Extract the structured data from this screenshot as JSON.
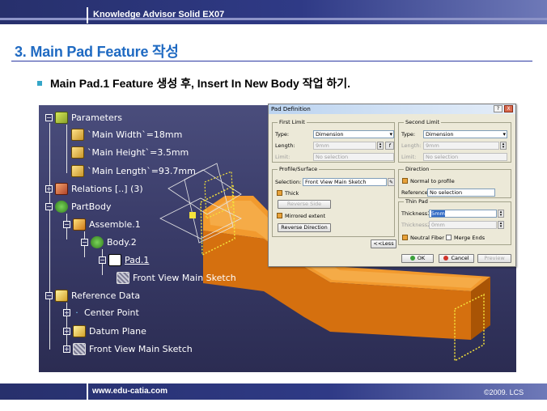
{
  "header": {
    "title": "Knowledge Advisor Solid EX07"
  },
  "slide": {
    "title": "3. Main Pad Feature 작성",
    "bullet": "Main Pad.1 Feature 생성 후,  Insert In New Body 작업 하기."
  },
  "tree": {
    "parameters": "Parameters",
    "main_width": "`Main Width`=18mm",
    "main_height": "`Main Height`=3.5mm",
    "main_length": "`Main Length`=93.7mm",
    "relations": "Relations [..] (3)",
    "partbody": "PartBody",
    "assemble": "Assemble.1",
    "body2": "Body.2",
    "pad1": "Pad.1",
    "front_sketch_1": "Front View Main Sketch",
    "reference_data": "Reference Data",
    "center_point": "Center Point",
    "datum_plane": "Datum Plane",
    "front_sketch_2": "Front View Main Sketch"
  },
  "dialog": {
    "title": "Pad Definition",
    "help": "?",
    "close": "X",
    "first_limit": {
      "label": "First Limit",
      "type_label": "Type:",
      "type_value": "Dimension",
      "length_label": "Length:",
      "length_value": "9mm",
      "limit_label": "Limit:",
      "limit_value": "No selection"
    },
    "second_limit": {
      "label": "Second Limit",
      "type_label": "Type:",
      "type_value": "Dimension",
      "length_label": "Length:",
      "length_value": "9mm",
      "limit_label": "Limit:",
      "limit_value": "No selection"
    },
    "profile": {
      "label": "Profile/Surface",
      "selection_label": "Selection:",
      "selection_value": "Front View Main Sketch",
      "thick_label": "Thick",
      "reverse_side": "Reverse Side",
      "mirrored_label": "Mirrored extent",
      "reverse_direction": "Reverse Direction"
    },
    "direction": {
      "label": "Direction",
      "normal_label": "Normal to profile",
      "reference_label": "Reference:",
      "reference_value": "No selection"
    },
    "thin_pad": {
      "label": "Thin Pad",
      "thickness1_label": "Thickness1:",
      "thickness1_value": "5mm",
      "thickness2_label": "Thickness2:",
      "thickness2_value": "0mm",
      "neutral_fiber": "Neutral Fiber",
      "merge_ends": "Merge Ends"
    },
    "less_button": "<<Less",
    "ok": "OK",
    "cancel": "Cancel",
    "preview": "Preview"
  },
  "footer": {
    "url": "www.edu-catia.com",
    "copyright": "©2009. LCS"
  },
  "colors": {
    "header": "#2f3a86",
    "title_blue": "#1f6ac2",
    "part_orange": "#e07a14",
    "viewport": "#3b3d6a"
  }
}
